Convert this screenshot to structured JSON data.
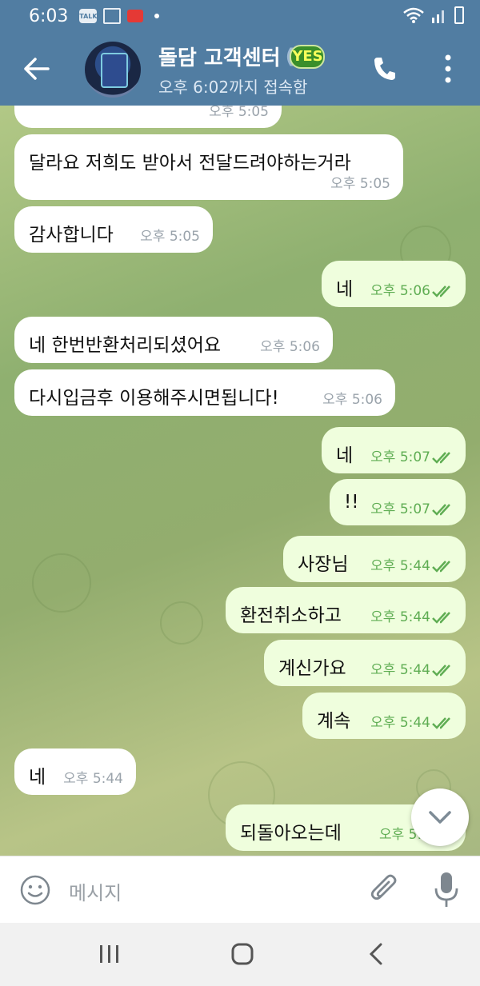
{
  "status_bar": {
    "time": "6:03",
    "talk_badge": "TALK"
  },
  "header": {
    "title": "돌담 고객센터",
    "title_paren": "(",
    "badge": "YES",
    "subtitle": "오후 6:02까지 접속함",
    "colors": {
      "bar": "#517da2",
      "badge": "#3a8f2a"
    }
  },
  "messages": [
    {
      "dir": "in",
      "text": "",
      "time": "오후 5:05"
    },
    {
      "dir": "in",
      "text": "달라요 저희도 받아서 전달드려야하는거라",
      "time": "오후 5:05"
    },
    {
      "dir": "in",
      "text": "감사합니다",
      "time": "오후 5:05"
    },
    {
      "dir": "out",
      "text": "네",
      "time": "오후 5:06"
    },
    {
      "dir": "in",
      "text": "네 한번반환처리되셨어요",
      "time": "오후 5:06"
    },
    {
      "dir": "in",
      "text": "다시입금후 이용해주시면됩니다!",
      "time": "오후 5:06"
    },
    {
      "dir": "out",
      "text": "네",
      "time": "오후 5:07"
    },
    {
      "dir": "out",
      "text": "!!",
      "time": "오후 5:07"
    },
    {
      "dir": "out",
      "text": "사장님",
      "time": "오후 5:44"
    },
    {
      "dir": "out",
      "text": "환전취소하고",
      "time": "오후 5:44"
    },
    {
      "dir": "out",
      "text": "계신가요",
      "time": "오후 5:44"
    },
    {
      "dir": "out",
      "text": "계속",
      "time": "오후 5:44"
    },
    {
      "dir": "in",
      "text": "네",
      "time": "오후 5:44"
    },
    {
      "dir": "out",
      "text": "되돌아오는데",
      "time": "오후 5:4"
    }
  ],
  "composer": {
    "placeholder": "메시지"
  },
  "icons": {
    "back": "arrow-left-icon",
    "call": "phone-icon",
    "more": "more-vertical-icon",
    "emoji": "emoji-icon",
    "attach": "paperclip-icon",
    "mic": "microphone-icon",
    "scroll": "chevron-down-icon"
  }
}
